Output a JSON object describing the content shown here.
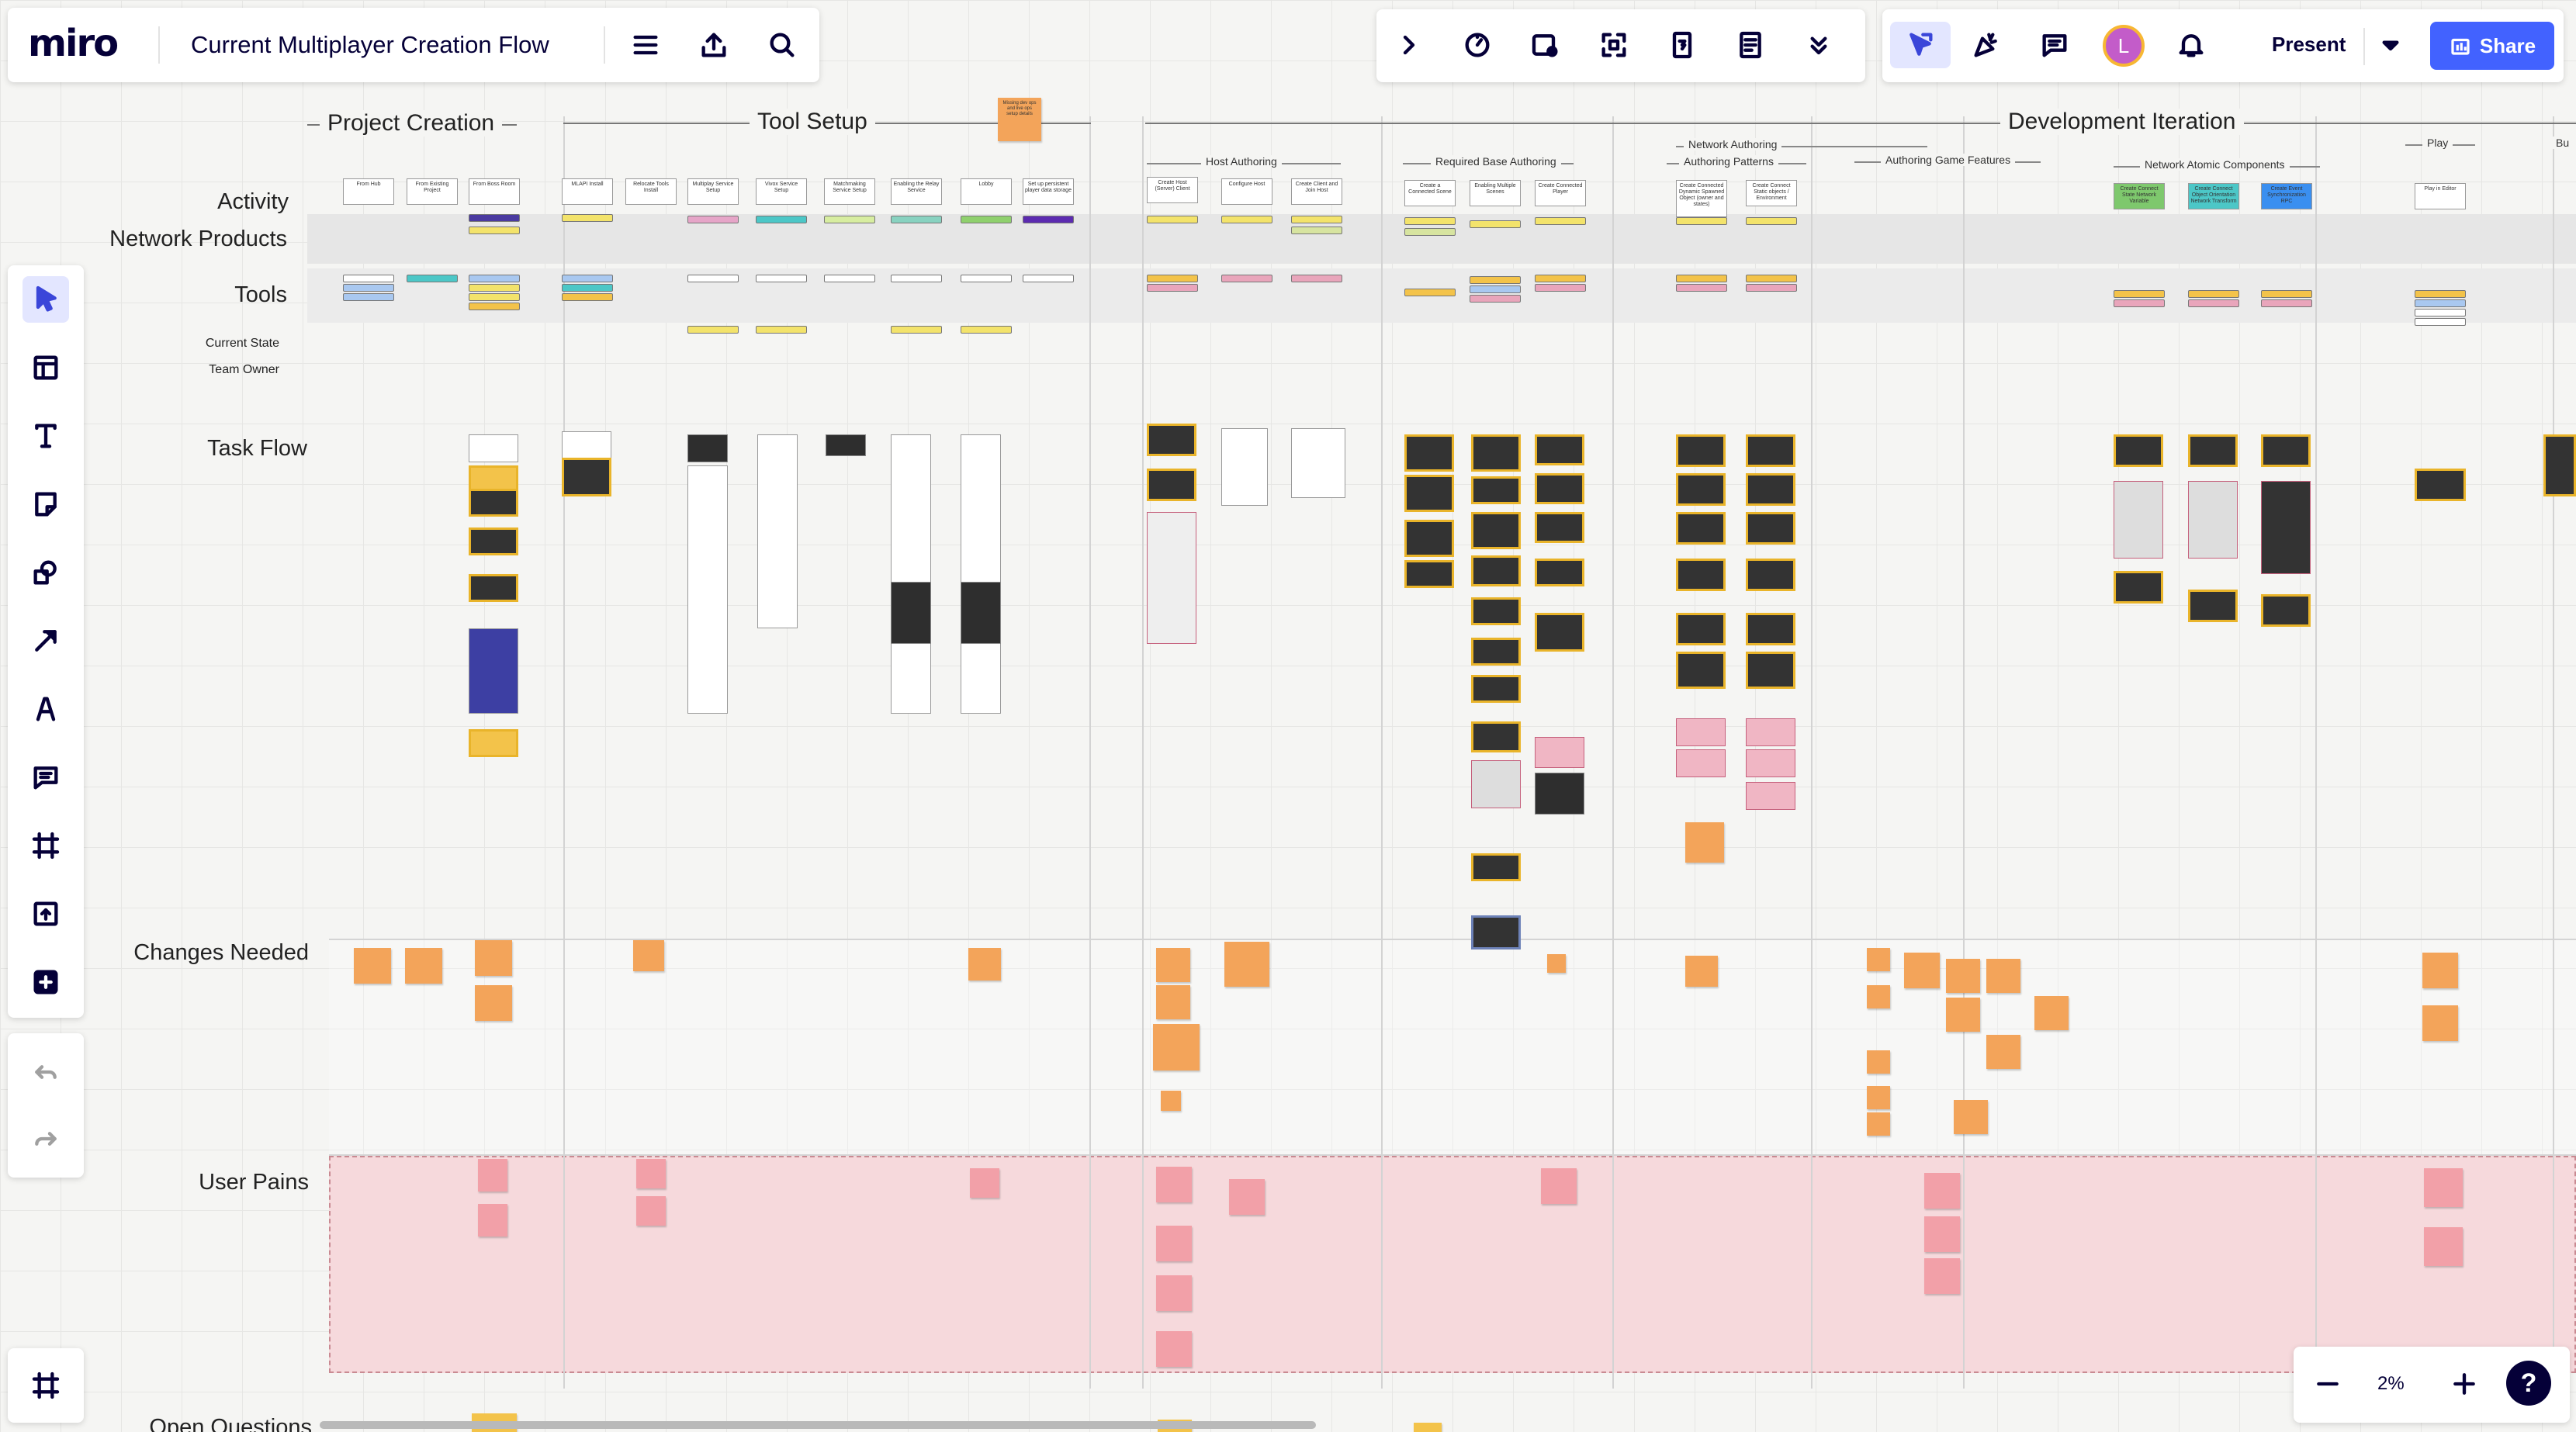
{
  "header": {
    "logo": "miro",
    "board_title": "Current Multiplayer Creation Flow"
  },
  "topbar": {
    "present_label": "Present",
    "share_label": "Share",
    "avatar_initial": "L"
  },
  "zoom": {
    "level": "2%",
    "help": "?"
  },
  "board": {
    "sections": {
      "project_creation": "Project Creation",
      "tool_setup": "Tool Setup",
      "development_iteration": "Development Iteration"
    },
    "subsections": {
      "network_authoring": "Network Authoring",
      "host_authoring": "Host Authoring",
      "required_base_authoring": "Required Base Authoring",
      "authoring_patterns": "Authoring Patterns",
      "authoring_game_features": "Authoring Game Features",
      "network_atomic_components": "Network Atomic Components",
      "play": "Play",
      "bu": "Bu"
    },
    "rows": {
      "activity": "Activity",
      "network_products": "Network Products",
      "tools": "Tools",
      "current_state": "Current State",
      "team_owner": "Team Owner",
      "task_flow": "Task Flow",
      "changes_needed": "Changes Needed",
      "user_pains": "User Pains",
      "open_questions": "Open Questions"
    },
    "activities": [
      "From Hub",
      "From Existing Project",
      "From Boss Room",
      "MLAPI Install",
      "Relocate Tools Install",
      "Multiplay Service Setup",
      "Vivox Service Setup",
      "Matchmaking Service Setup",
      "Enabling the Relay Service",
      "Lobby",
      "Set up persistent player data storage",
      "Create Host (Server) Client",
      "Configure Host",
      "Create Client and Join Host",
      "Create a Connected Scene",
      "Enabling Multiple Scenes",
      "Create Connected Player",
      "Create Connected Dynamic Spawned Object (owner and states)",
      "Create Connect Static objects / Environment",
      "Create Connect State Network Variable",
      "Create Connect Object Orientation Network Transform",
      "Create Event Synchronization RPC",
      "Play in Editor"
    ],
    "top_sticky": "Missing dev ops and live ops setup details"
  }
}
